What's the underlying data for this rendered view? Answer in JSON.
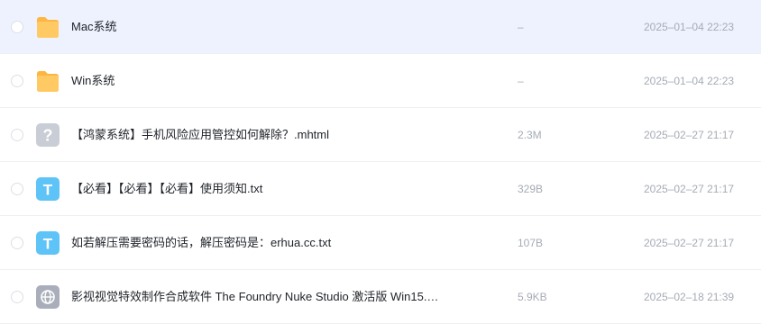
{
  "colors": {
    "selected_row_bg": "#eef2fe",
    "folder_icon": "#ffc25a",
    "text_icon": "#66c8f7",
    "unknown_icon": "#c8ccd6",
    "web_icon": "#a9aeba",
    "secondary_text": "#a6abb5"
  },
  "files": [
    {
      "name": "Mac系统",
      "size": "–",
      "date": "2025–01–04 22:23",
      "icon": "folder-icon",
      "selected": true
    },
    {
      "name": "Win系统",
      "size": "–",
      "date": "2025–01–04 22:23",
      "icon": "folder-icon"
    },
    {
      "name": "【鸿蒙系统】手机风险应用管控如何解除？.mhtml",
      "size": "2.3M",
      "date": "2025–02–27 21:17",
      "icon": "unknown-file-icon",
      "glyph": "?"
    },
    {
      "name": "【必看】【必看】【必看】使用须知.txt",
      "size": "329B",
      "date": "2025–02–27 21:17",
      "icon": "text-file-icon",
      "glyph": "T"
    },
    {
      "name": "如若解压需要密码的话，解压密码是：erhua.cc.txt",
      "size": "107B",
      "date": "2025–02–27 21:17",
      "icon": "text-file-icon",
      "glyph": "T"
    },
    {
      "name": "影视视觉特效制作合成软件 The Foundry Nuke Studio 激活版 Win15.…",
      "size": "5.9KB",
      "date": "2025–02–18 21:39",
      "icon": "web-file-icon"
    }
  ]
}
